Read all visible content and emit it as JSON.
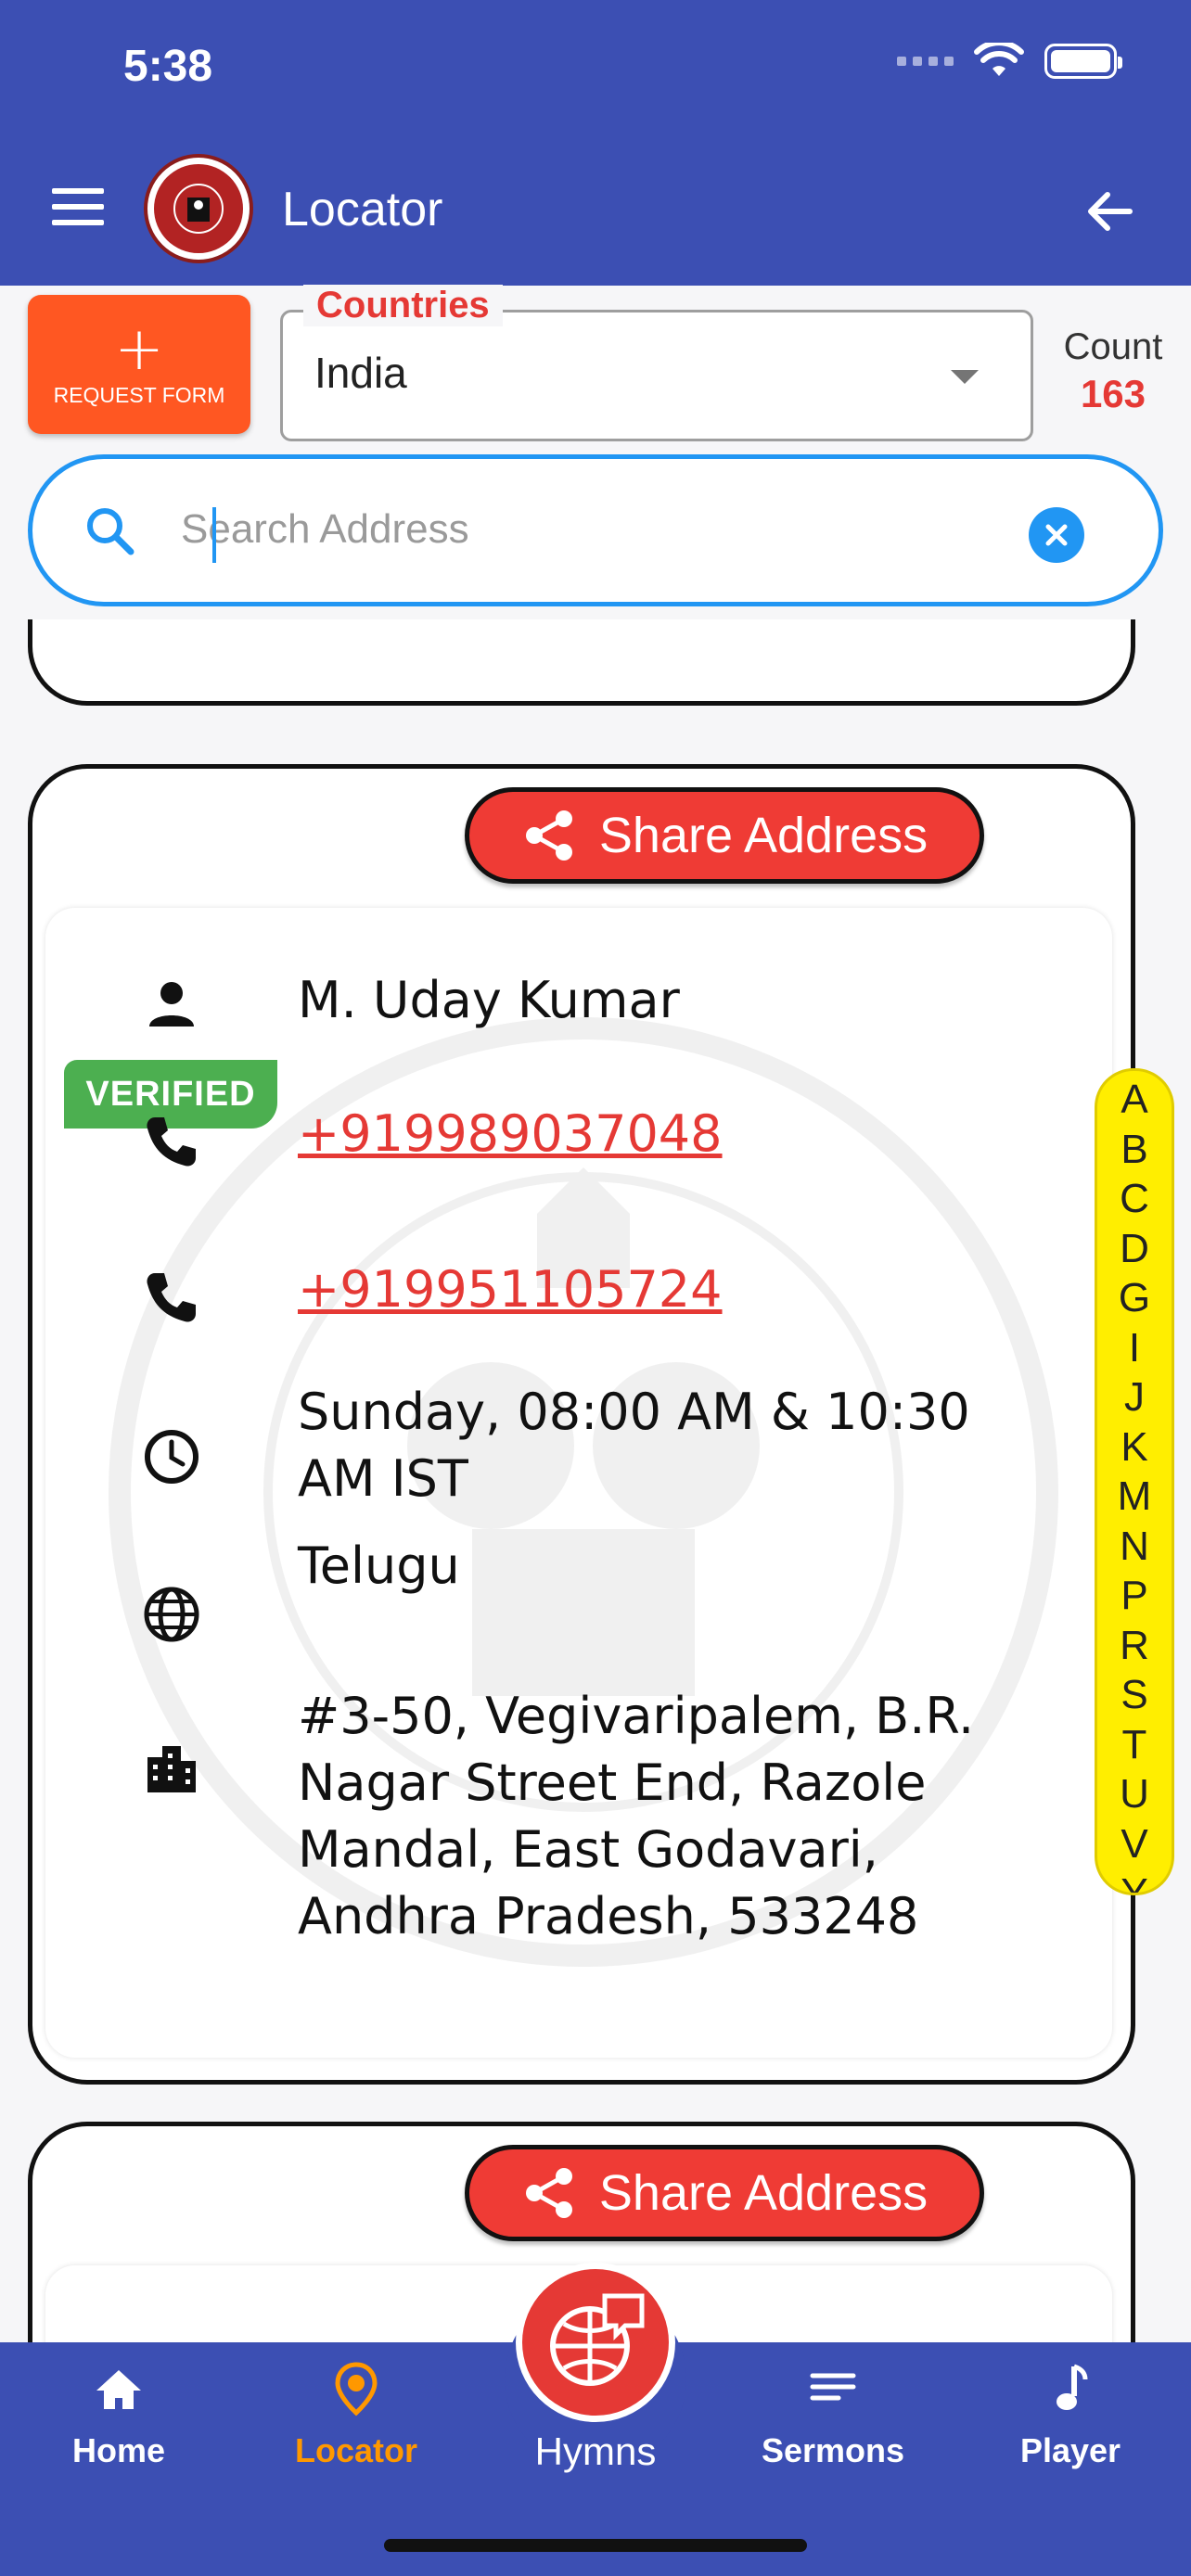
{
  "status": {
    "time": "5:38"
  },
  "header": {
    "title": "Locator"
  },
  "filters": {
    "request_form_label": "REQUEST FORM",
    "countries_label": "Countries",
    "country_value": "India",
    "count_label": "Count",
    "count_value": "163"
  },
  "search": {
    "placeholder": "Search Address",
    "value": ""
  },
  "card": {
    "share_label": "Share Address",
    "verified_label": "VERIFIED",
    "name": "M. Uday Kumar",
    "phone1": "+919989037048",
    "phone2": "+919951105724",
    "service_time": "Sunday, 08:00 AM & 10:30 AM IST",
    "language": "Telugu",
    "address": "#3-50, Vegivaripalem, B.R. Nagar Street End, Razole Mandal, East Godavari, Andhra Pradesh, 533248"
  },
  "next_card": {
    "share_label": "Share Address"
  },
  "alphabet": [
    "A",
    "B",
    "C",
    "D",
    "G",
    "I",
    "J",
    "K",
    "M",
    "N",
    "P",
    "R",
    "S",
    "T",
    "U",
    "V",
    "Y"
  ],
  "bottom_nav": {
    "home": "Home",
    "locator": "Locator",
    "hymns": "Hymns",
    "sermons": "Sermons",
    "player": "Player"
  },
  "colors": {
    "primary": "#3c4fb3",
    "accent_red": "#e53935",
    "request_orange": "#ff5722",
    "verified_green": "#4caf50",
    "search_blue": "#2196f3",
    "active_nav": "#ff9800",
    "alphabet_bg": "#ffee00"
  }
}
